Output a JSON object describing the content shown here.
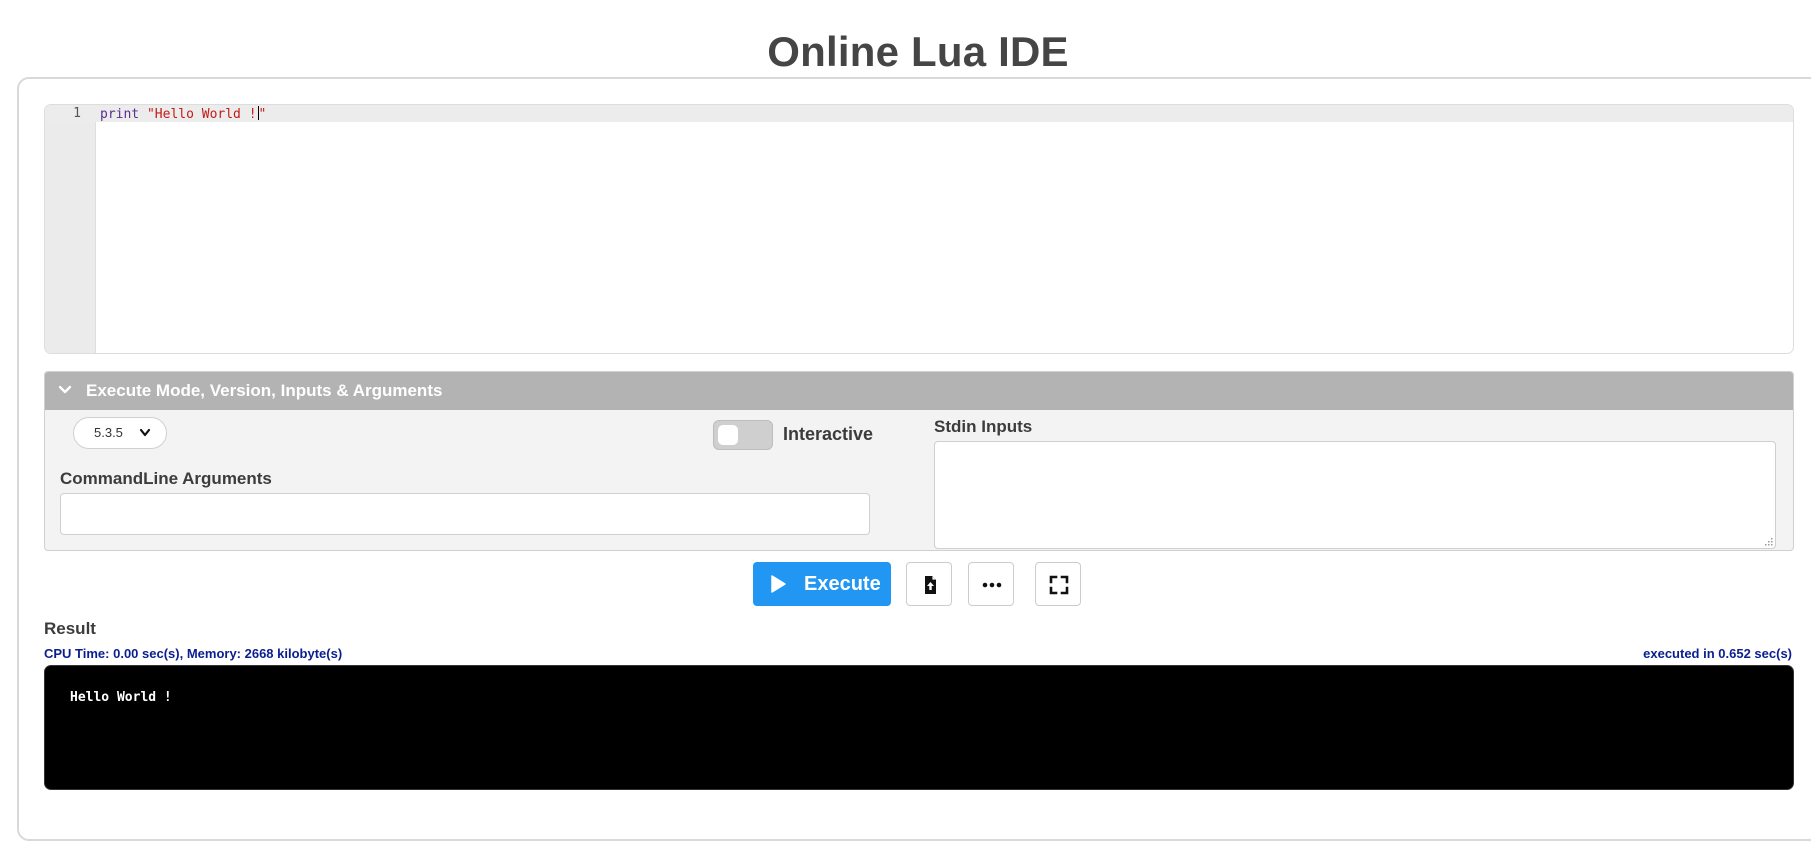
{
  "page": {
    "title": "Online Lua IDE"
  },
  "editor": {
    "line_number": "1",
    "code": {
      "keyword": "print",
      "string_before_cursor": "\"Hello World !",
      "string_after_cursor": "\""
    }
  },
  "options": {
    "header": "Execute Mode, Version, Inputs & Arguments",
    "version_selected": "5.3.5",
    "interactive_label": "Interactive",
    "interactive_enabled": false,
    "cmd_args_label": "CommandLine Arguments",
    "cmd_args_value": "",
    "stdin_label": "Stdin Inputs",
    "stdin_value": ""
  },
  "toolbar": {
    "execute_label": "Execute",
    "icons": [
      "upload-file-icon",
      "more-icon",
      "fullscreen-icon"
    ]
  },
  "result": {
    "label": "Result",
    "stats": "CPU Time: 0.00 sec(s), Memory: 2668 kilobyte(s)",
    "executed": "executed in 0.652 sec(s)",
    "output": "Hello World !"
  },
  "colors": {
    "accent": "#2196f3",
    "stats_text": "#0b1e90",
    "options_header_bg": "#b3b3b3",
    "console_bg": "#000000"
  }
}
